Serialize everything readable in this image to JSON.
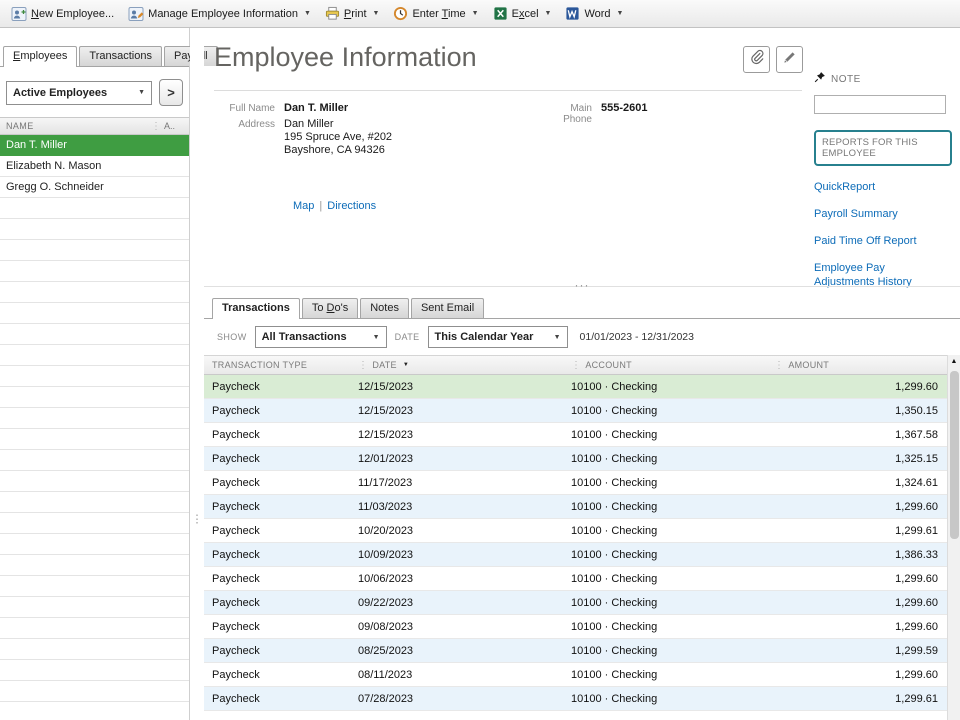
{
  "icons": {
    "dropdown_arrow": "▼",
    "sort_desc": "▼",
    "column_separator": "⋮",
    "splitter_v": "⋮",
    "splitter_h": "···",
    "scroll_up": "▲"
  },
  "toolbar": {
    "items": [
      {
        "label": "New Employee...",
        "icon": "new-employee-icon",
        "dropdown": false,
        "u": 0
      },
      {
        "label": "Manage Employee Information",
        "icon": "manage-employee-icon",
        "dropdown": true,
        "u": -1
      },
      {
        "label": "Print",
        "icon": "print-icon",
        "dropdown": true,
        "u": 0
      },
      {
        "label": "Enter Time",
        "icon": "enter-time-icon",
        "dropdown": true,
        "u": 6
      },
      {
        "label": "Excel",
        "icon": "excel-icon",
        "dropdown": true,
        "u": 1
      },
      {
        "label": "Word",
        "icon": "word-icon",
        "dropdown": true,
        "u": -1
      }
    ]
  },
  "sidebar": {
    "tabs": [
      {
        "label": "Employees",
        "active": true,
        "u": 0
      },
      {
        "label": "Transactions",
        "active": false,
        "u": -1
      },
      {
        "label": "Payroll",
        "active": false,
        "u": 2
      }
    ],
    "filter_value": "Active Employees",
    "expand_button": ">",
    "columns": [
      "NAME",
      "A.."
    ],
    "employees": [
      {
        "name": "Dan T. Miller",
        "selected": true
      },
      {
        "name": "Elizabeth N. Mason",
        "selected": false
      },
      {
        "name": "Gregg O. Schneider",
        "selected": false
      }
    ]
  },
  "main": {
    "title": "Employee Information",
    "fields": {
      "full_name_label": "Full Name",
      "full_name": "Dan T. Miller",
      "main_phone_label": "Main Phone",
      "main_phone": "555-2601",
      "address_label": "Address",
      "address_lines": [
        "Dan Miller",
        "195 Spruce Ave, #202",
        "Bayshore, CA 94326"
      ]
    },
    "links": {
      "map": "Map",
      "separator": "|",
      "directions": "Directions"
    }
  },
  "note_panel": {
    "note_label": "NOTE",
    "note_value": "",
    "reports_title": "REPORTS FOR THIS EMPLOYEE",
    "report_links": [
      "QuickReport",
      "Payroll Summary",
      "Paid Time Off Report",
      "Employee Pay Adjustments History"
    ]
  },
  "transactions": {
    "tabs": [
      {
        "label": "Transactions",
        "active": true,
        "u": -1
      },
      {
        "label": "To Do's",
        "active": false,
        "u": 3
      },
      {
        "label": "Notes",
        "active": false,
        "u": -1
      },
      {
        "label": "Sent Email",
        "active": false,
        "u": -1
      }
    ],
    "show_label": "SHOW",
    "show_value": "All Transactions",
    "date_label": "DATE",
    "date_value": "This Calendar Year",
    "date_range": "01/01/2023 - 12/31/2023",
    "columns": [
      "TRANSACTION TYPE",
      "DATE",
      "ACCOUNT",
      "AMOUNT"
    ],
    "rows": [
      {
        "type": "Paycheck",
        "date": "12/15/2023",
        "account": "10100 · Checking",
        "amount": "1,299.60"
      },
      {
        "type": "Paycheck",
        "date": "12/15/2023",
        "account": "10100 · Checking",
        "amount": "1,350.15"
      },
      {
        "type": "Paycheck",
        "date": "12/15/2023",
        "account": "10100 · Checking",
        "amount": "1,367.58"
      },
      {
        "type": "Paycheck",
        "date": "12/01/2023",
        "account": "10100 · Checking",
        "amount": "1,325.15"
      },
      {
        "type": "Paycheck",
        "date": "11/17/2023",
        "account": "10100 · Checking",
        "amount": "1,324.61"
      },
      {
        "type": "Paycheck",
        "date": "11/03/2023",
        "account": "10100 · Checking",
        "amount": "1,299.60"
      },
      {
        "type": "Paycheck",
        "date": "10/20/2023",
        "account": "10100 · Checking",
        "amount": "1,299.61"
      },
      {
        "type": "Paycheck",
        "date": "10/09/2023",
        "account": "10100 · Checking",
        "amount": "1,386.33"
      },
      {
        "type": "Paycheck",
        "date": "10/06/2023",
        "account": "10100 · Checking",
        "amount": "1,299.60"
      },
      {
        "type": "Paycheck",
        "date": "09/22/2023",
        "account": "10100 · Checking",
        "amount": "1,299.60"
      },
      {
        "type": "Paycheck",
        "date": "09/08/2023",
        "account": "10100 · Checking",
        "amount": "1,299.60"
      },
      {
        "type": "Paycheck",
        "date": "08/25/2023",
        "account": "10100 · Checking",
        "amount": "1,299.59"
      },
      {
        "type": "Paycheck",
        "date": "08/11/2023",
        "account": "10100 · Checking",
        "amount": "1,299.60"
      },
      {
        "type": "Paycheck",
        "date": "07/28/2023",
        "account": "10100 · Checking",
        "amount": "1,299.61"
      }
    ]
  }
}
